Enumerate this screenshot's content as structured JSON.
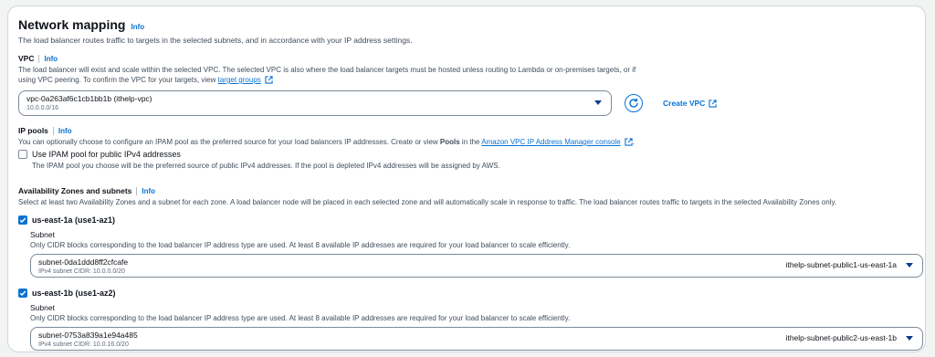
{
  "title": "Network mapping",
  "info_label": "Info",
  "description": "The load balancer routes traffic to targets in the selected subnets, and in accordance with your IP address settings.",
  "vpc": {
    "label": "VPC",
    "info": "Info",
    "description_line1": "The load balancer will exist and scale within the selected VPC. The selected VPC is also where the load balancer targets must be hosted unless routing to Lambda or on-premises targets, or if",
    "description_line2_prefix": "using VPC peering. To confirm the VPC for your targets, view ",
    "target_groups_link": "target groups",
    "selected_value": "vpc-0a263af6c1cb1bb1b (ithelp-vpc)",
    "selected_cidr": "10.0.0.0/16",
    "create_vpc_label": "Create VPC"
  },
  "ip_pools": {
    "label": "IP pools",
    "info": "Info",
    "description_prefix": "You can optionally choose to configure an IPAM pool as the preferred source for your load balancers IP addresses. Create or view ",
    "description_bold": "Pools",
    "description_mid": " in the ",
    "console_link": "Amazon VPC IP Address Manager console",
    "description_suffix": ".",
    "checkbox_label": "Use IPAM pool for public IPv4 addresses",
    "checkbox_checked": false,
    "checkbox_desc": "The IPAM pool you choose will be the preferred source of public IPv4 addresses. If the pool is depleted IPv4 addresses will be assigned by AWS."
  },
  "az": {
    "label": "Availability Zones and subnets",
    "info": "Info",
    "description": "Select at least two Availability Zones and a subnet for each zone. A load balancer node will be placed in each selected zone and will automatically scale in response to traffic. The load balancer routes traffic to targets in the selected Availability Zones only.",
    "zones": [
      {
        "label": "us-east-1a (use1-az1)",
        "checked": true,
        "subnet_label": "Subnet",
        "subnet_desc": "Only CIDR blocks corresponding to the load balancer IP address type are used. At least 8 available IP addresses are required for your load balancer to scale efficiently.",
        "subnet_id": "subnet-0da1ddd8ff2cfcafe",
        "subnet_cidr": "IPv4 subnet CIDR: 10.0.0.0/20",
        "subnet_name": "ithelp-subnet-public1-us-east-1a"
      },
      {
        "label": "us-east-1b (use1-az2)",
        "checked": true,
        "subnet_label": "Subnet",
        "subnet_desc": "Only CIDR blocks corresponding to the load balancer IP address type are used. At least 8 available IP addresses are required for your load balancer to scale efficiently.",
        "subnet_id": "subnet-0753a839a1e94a485",
        "subnet_cidr": "IPv4 subnet CIDR: 10.0.16.0/20",
        "subnet_name": "ithelp-subnet-public2-us-east-1b"
      }
    ]
  },
  "colors": {
    "accent": "#0972d3",
    "border": "#7d8998",
    "text": "#0f141a",
    "muted": "#414d5c"
  }
}
